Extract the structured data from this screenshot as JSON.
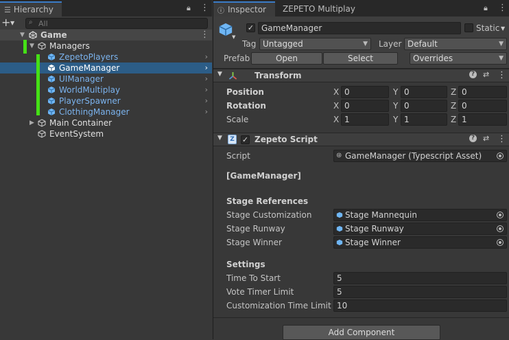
{
  "hierarchy": {
    "tab_label": "Hierarchy",
    "search_placeholder": "All",
    "scene": "Game",
    "items": [
      {
        "label": "Managers"
      },
      {
        "label": "ZepetoPlayers"
      },
      {
        "label": "GameManager"
      },
      {
        "label": "UIManager"
      },
      {
        "label": "WorldMultiplay"
      },
      {
        "label": "PlayerSpawner"
      },
      {
        "label": "ClothingManager"
      },
      {
        "label": "Main Container"
      },
      {
        "label": "EventSystem"
      }
    ]
  },
  "inspector": {
    "tabs": [
      {
        "label": "Inspector"
      },
      {
        "label": "ZEPETO Multiplay"
      }
    ],
    "object_name": "GameManager",
    "static_label": "Static",
    "tag_label": "Tag",
    "tag_value": "Untagged",
    "layer_label": "Layer",
    "layer_value": "Default",
    "prefab_label": "Prefab",
    "prefab_open": "Open",
    "prefab_select": "Select",
    "prefab_overrides": "Overrides",
    "transform": {
      "title": "Transform",
      "rows": [
        {
          "label": "Position",
          "x": "0",
          "y": "0",
          "z": "0"
        },
        {
          "label": "Rotation",
          "x": "0",
          "y": "0",
          "z": "0"
        },
        {
          "label": "Scale",
          "x": "1",
          "y": "1",
          "z": "1"
        }
      ],
      "x_label": "X",
      "y_label": "Y",
      "z_label": "Z"
    },
    "script_component": {
      "title": "Zepeto Script",
      "script_label": "Script",
      "script_value": "GameManager (Typescript Asset)",
      "class_header": "[GameManager]",
      "stage_header": "Stage References",
      "stage_rows": [
        {
          "label": "Stage Customization",
          "value": "Stage Mannequin"
        },
        {
          "label": "Stage Runway",
          "value": "Stage Runway"
        },
        {
          "label": "Stage Winner",
          "value": "Stage Winner"
        }
      ],
      "settings_header": "Settings",
      "settings_rows": [
        {
          "label": "Time To Start",
          "value": "5"
        },
        {
          "label": "Vote Timer Limit",
          "value": "5"
        },
        {
          "label": "Customization Time Limit",
          "value": "10"
        }
      ]
    },
    "add_component": "Add Component"
  }
}
